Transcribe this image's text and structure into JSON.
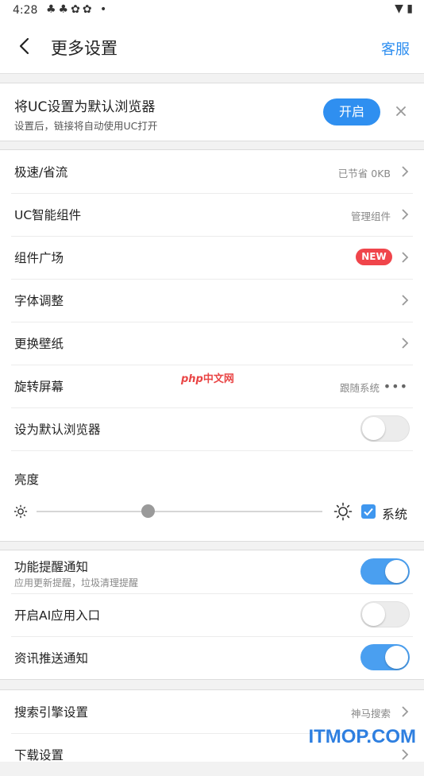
{
  "status": {
    "time": "4:28",
    "notif_glyphs": "♣♣✿✿ •",
    "sys_glyphs": "▼ ▮"
  },
  "header": {
    "title": "更多设置",
    "service": "客服"
  },
  "banner": {
    "title": "将UC设置为默认浏览器",
    "subtitle": "设置后，链接将自动使用UC打开",
    "enable": "开启"
  },
  "group1": [
    {
      "label": "极速/省流",
      "value": "已节省 0KB"
    },
    {
      "label": "UC智能组件",
      "value": "管理组件"
    },
    {
      "label": "组件广场",
      "badge": "NEW"
    },
    {
      "label": "字体调整"
    },
    {
      "label": "更换壁纸"
    },
    {
      "label": "旋转屏幕",
      "value": "跟随系统",
      "more": "•••"
    },
    {
      "label": "设为默认浏览器",
      "toggle": false
    }
  ],
  "brightness": {
    "label": "亮度",
    "value": 0.39,
    "system_label": "系统",
    "system_checked": true
  },
  "group2": [
    {
      "label": "功能提醒通知",
      "sublabel": "应用更新提醒，垃圾清理提醒",
      "toggle": true
    },
    {
      "label": "开启AI应用入口",
      "toggle": false
    },
    {
      "label": "资讯推送通知",
      "toggle": true
    }
  ],
  "group3": [
    {
      "label": "搜索引擎设置",
      "value": "神马搜索"
    },
    {
      "label": "下载设置"
    }
  ],
  "overlay": {
    "php_a": "php",
    "php_b": "中文网",
    "watermark": "ITMOP.COM"
  },
  "colors": {
    "accent": "#2f8ff0",
    "badge": "#f0454b",
    "toggle_on": "#4a9ff0"
  }
}
